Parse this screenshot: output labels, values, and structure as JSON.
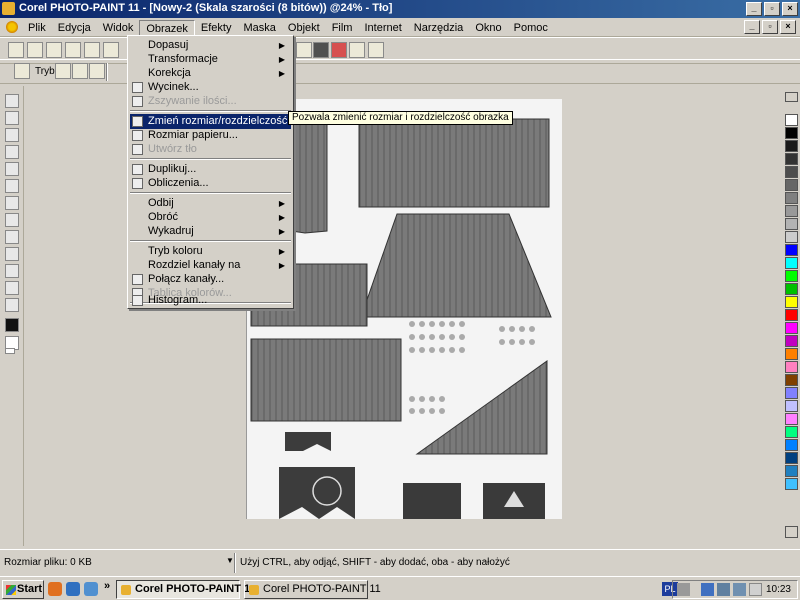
{
  "window": {
    "title": "Corel PHOTO-PAINT 11 - [Nowy-2 (Skala szarości (8 bitów)) @24% - Tło]",
    "minimize_glyph": "_",
    "maximize_glyph": "▫",
    "close_glyph": "×"
  },
  "menubar": {
    "items": [
      "Plik",
      "Edycja",
      "Widok",
      "Obrazek",
      "Efekty",
      "Maska",
      "Objekt",
      "Film",
      "Internet",
      "Narzędzia",
      "Okno",
      "Pomoc"
    ],
    "active_index": 3
  },
  "toolbar2": {
    "label": "Tryb"
  },
  "image_menu": {
    "items": [
      {
        "label": "Dopasuj",
        "submenu": true,
        "disabled": false
      },
      {
        "label": "Transformacje",
        "submenu": true,
        "disabled": false
      },
      {
        "label": "Korekcja",
        "submenu": true,
        "disabled": false
      },
      {
        "label": "Wycinek...",
        "submenu": false,
        "disabled": false,
        "icon": "crop-icon"
      },
      {
        "label": "Zszywanie ilości...",
        "submenu": false,
        "disabled": true,
        "icon": "stitch-icon"
      },
      {
        "label": "Zmień rozmiar/rozdzielczość...",
        "submenu": false,
        "disabled": false,
        "highlighted": true,
        "icon": "resample-icon"
      },
      {
        "label": "Rozmiar papieru...",
        "submenu": false,
        "disabled": false,
        "icon": "paper-size-icon"
      },
      {
        "label": "Utwórz tło",
        "submenu": false,
        "disabled": true,
        "icon": "create-background-icon"
      },
      {
        "label": "Duplikuj...",
        "submenu": false,
        "disabled": false,
        "icon": "duplicate-icon"
      },
      {
        "label": "Obliczenia...",
        "submenu": false,
        "disabled": false,
        "icon": "calculations-icon"
      },
      {
        "label": "Odbij",
        "submenu": true,
        "disabled": false
      },
      {
        "label": "Obróć",
        "submenu": true,
        "disabled": false
      },
      {
        "label": "Wykadruj",
        "submenu": true,
        "disabled": false
      },
      {
        "label": "Tryb koloru",
        "submenu": true,
        "disabled": false
      },
      {
        "label": "Rozdziel kanały na",
        "submenu": true,
        "disabled": false
      },
      {
        "label": "Połącz kanały...",
        "submenu": false,
        "disabled": false,
        "icon": "combine-channels-icon"
      },
      {
        "label": "Tablica kolorów...",
        "submenu": false,
        "disabled": true,
        "icon": "color-table-icon"
      },
      {
        "label": "Histogram...",
        "submenu": false,
        "disabled": false,
        "icon": "histogram-icon"
      }
    ],
    "submenu_arrow": "▶"
  },
  "tooltip": "Pozwala zmienić rozmiar i rozdzielczość obrazka",
  "statusbar": {
    "file_size": "Rozmiar pliku: 0 KB",
    "hint": "Użyj CTRL, aby odjąć, SHIFT - aby dodać, oba - aby nałożyć",
    "arrow": "▼"
  },
  "taskbar": {
    "start": "Start",
    "chevron": "»",
    "tasks": [
      "Corel PHOTO-PAINT 1...",
      "Corel PHOTO-PAINT 11"
    ],
    "language": "PL",
    "clock": "10:23"
  },
  "palette_colors": [
    "#ffffff",
    "#000000",
    "#1a1a1a",
    "#333333",
    "#4d4d4d",
    "#666666",
    "#808080",
    "#999999",
    "#b3b3b3",
    "#cccccc",
    "#e6e6e6",
    "#ffffff",
    "#0000ff",
    "#00ffff",
    "#00ff00",
    "#00c000",
    "#ffff00",
    "#ff0000",
    "#ff00ff",
    "#c000c0",
    "#ff8000",
    "#ff80c0",
    "#804000",
    "#8080ff",
    "#c0c0ff",
    "#ff80ff",
    "#00ff80",
    "#0080ff",
    "#004080",
    "#2080c0",
    "#40c0ff"
  ]
}
